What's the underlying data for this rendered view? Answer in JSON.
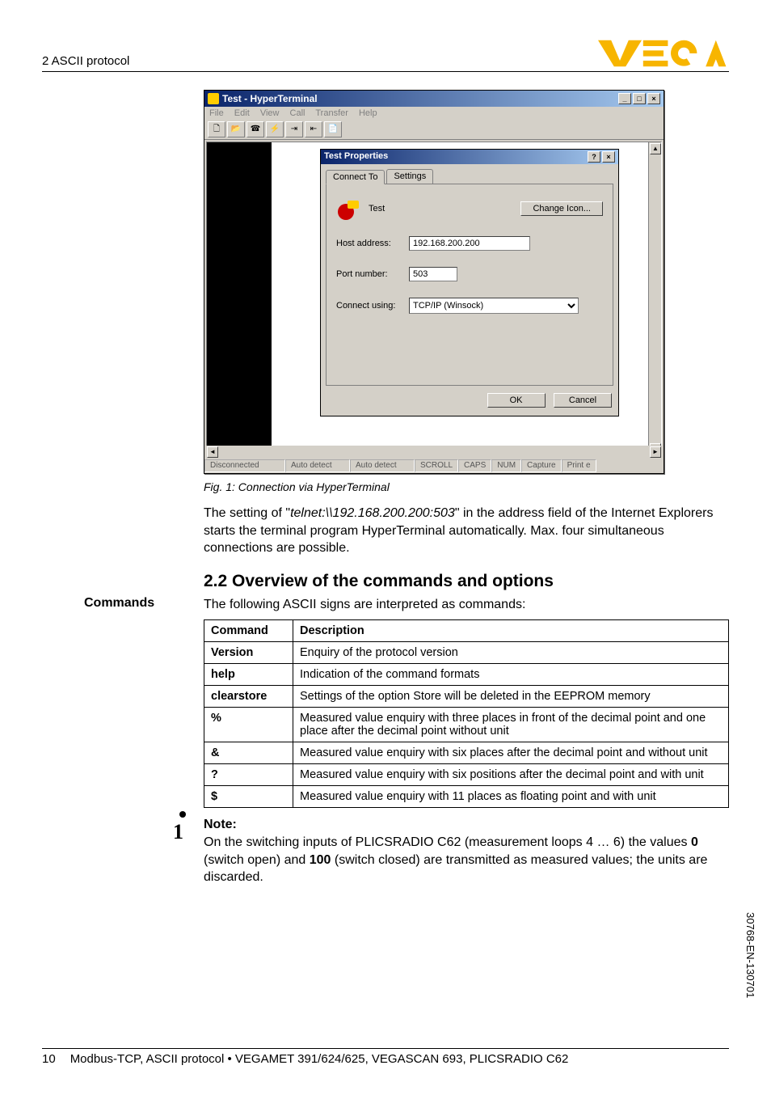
{
  "header": {
    "section": "2 ASCII protocol",
    "logo_text": "VEGA"
  },
  "ht": {
    "title": "Test - HyperTerminal",
    "menu": [
      "File",
      "Edit",
      "View",
      "Call",
      "Transfer",
      "Help"
    ],
    "status": {
      "conn": "Disconnected",
      "detect1": "Auto detect",
      "detect2": "Auto detect",
      "scroll": "SCROLL",
      "caps": "CAPS",
      "num": "NUM",
      "capture": "Capture",
      "print": "Print e"
    }
  },
  "props": {
    "title": "Test Properties",
    "tab1": "Connect To",
    "tab2": "Settings",
    "conn_name": "Test",
    "change_icon": "Change Icon...",
    "host_label": "Host address:",
    "host_value": "192.168.200.200",
    "port_label": "Port number:",
    "port_value": "503",
    "using_label": "Connect using:",
    "using_value": "TCP/IP (Winsock)",
    "ok": "OK",
    "cancel": "Cancel"
  },
  "fig_caption": "Fig. 1: Connection via HyperTerminal",
  "para1a": "The setting of \"",
  "para1b": "telnet:\\\\192.168.200.200:503",
  "para1c": "\" in the address field of the Internet Explorers starts the terminal program HyperTerminal automatically. Max. four simultaneous connections are possible.",
  "sec22": "2.2   Overview of the commands and options",
  "commands_label": "Commands",
  "para2": "The following ASCII signs are interpreted as commands:",
  "table": {
    "h1": "Command",
    "h2": "Description",
    "rows": [
      {
        "c": "Version",
        "d": "Enquiry of the protocol version"
      },
      {
        "c": "help",
        "d": "Indication of the command formats"
      },
      {
        "c": "clearstore",
        "d": "Settings of the option Store will be deleted in the EEPROM memory"
      },
      {
        "c": "%",
        "d": "Measured value enquiry with three places in front of the decimal point and one place after the decimal point without unit"
      },
      {
        "c": "&",
        "d": "Measured value enquiry with six places after the decimal point and without unit"
      },
      {
        "c": "?",
        "d": "Measured value enquiry with six positions after the decimal point and with unit"
      },
      {
        "c": "$",
        "d": "Measured value enquiry with 11 places as floating point and with unit"
      }
    ]
  },
  "note": {
    "title": "Note:",
    "body_a": "On the switching inputs of PLICSRADIO C62 (measurement loops 4 … 6) the values ",
    "b0": "0",
    "body_b": " (switch open) and ",
    "b100": "100",
    "body_c": " (switch closed) are transmitted as measured values; the units are discarded."
  },
  "footer": {
    "page": "10",
    "text": "Modbus-TCP, ASCII protocol • VEGAMET 391/624/625, VEGASCAN 693, PLICSRADIO C62"
  },
  "side_code": "30768-EN-130701"
}
